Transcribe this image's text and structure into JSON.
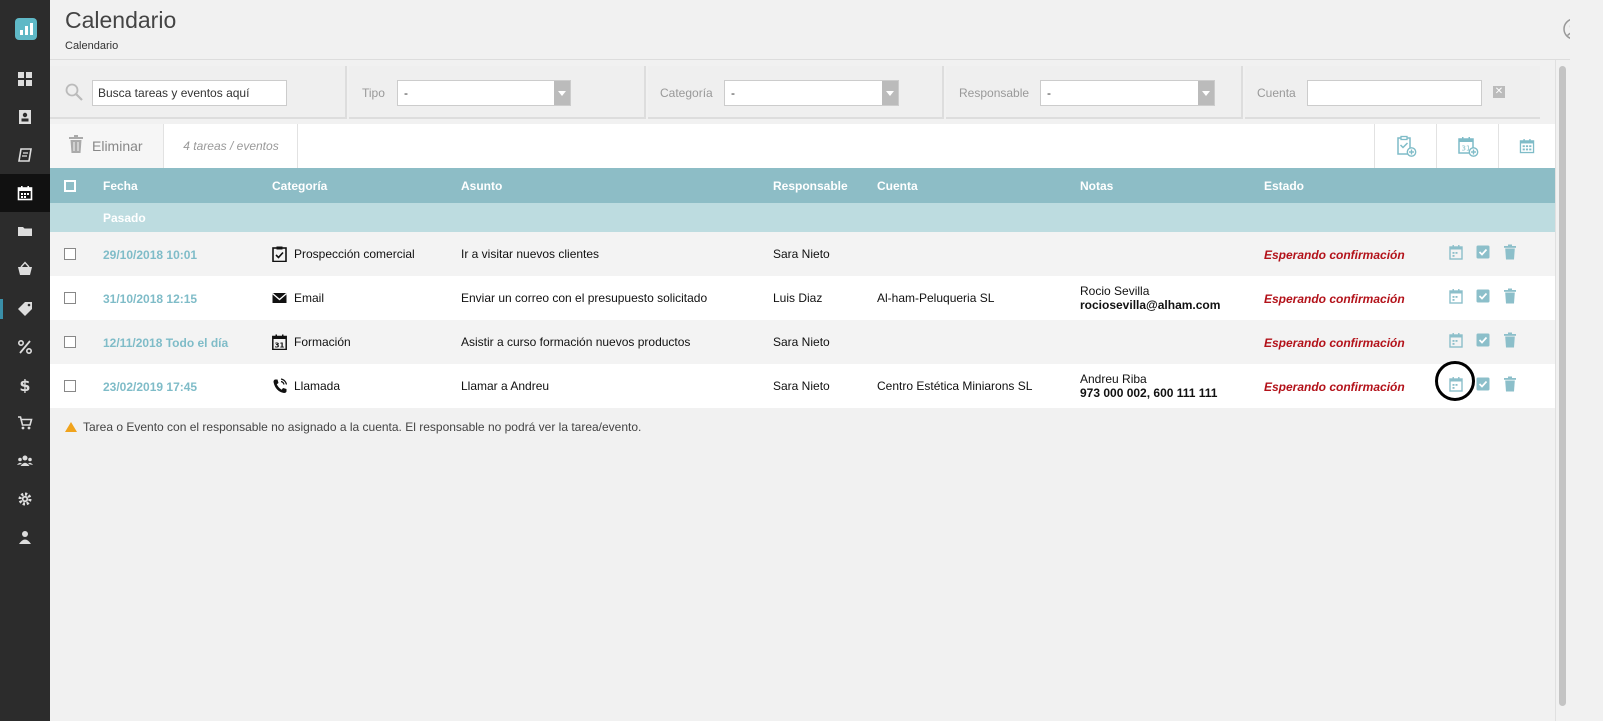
{
  "header": {
    "title": "Calendario",
    "subtitle": "Calendario"
  },
  "sidebar": {
    "items": [
      {
        "icon": "dashboard-icon"
      },
      {
        "icon": "contacts-book-icon"
      },
      {
        "icon": "receipt-icon"
      },
      {
        "icon": "calendar-icon",
        "active": true
      },
      {
        "icon": "folder-icon"
      },
      {
        "icon": "basket-icon"
      },
      {
        "icon": "tag-icon"
      },
      {
        "icon": "percent-icon"
      },
      {
        "icon": "dollar-icon"
      },
      {
        "icon": "cart-icon"
      },
      {
        "icon": "users-icon"
      },
      {
        "icon": "gear-icon"
      },
      {
        "icon": "user-icon"
      }
    ]
  },
  "filters": {
    "search_value": "Busca tareas y eventos aquí",
    "tipo_label": "Tipo",
    "tipo_value": "-",
    "categoria_label": "Categoría",
    "categoria_value": "-",
    "responsable_label": "Responsable",
    "responsable_value": "-",
    "cuenta_label": "Cuenta",
    "cuenta_value": "",
    "clear_glyph": "✕"
  },
  "toolbar": {
    "delete_label": "Eliminar",
    "count_label": "4 tareas / eventos"
  },
  "table": {
    "headers": {
      "fecha": "Fecha",
      "categoria": "Categoría",
      "asunto": "Asunto",
      "responsable": "Responsable",
      "cuenta": "Cuenta",
      "notas": "Notas",
      "estado": "Estado"
    },
    "group_label": "Pasado",
    "rows": [
      {
        "fecha": "29/10/2018 10:01",
        "categoria": "Prospección comercial",
        "cat_icon": "clipboard-check-icon",
        "asunto": "Ir a visitar nuevos clientes",
        "responsable": "Sara Nieto",
        "cuenta": "",
        "notas1": "",
        "notas2": "",
        "estado": "Esperando confirmación"
      },
      {
        "fecha": "31/10/2018 12:15",
        "categoria": "Email",
        "cat_icon": "envelope-icon",
        "asunto": "Enviar un correo con el presupuesto solicitado",
        "responsable": "Luis Diaz",
        "cuenta": "Al-ham-Peluqueria SL",
        "notas1": "Rocio Sevilla",
        "notas2": "rociosevilla@alham.com",
        "estado": "Esperando confirmación"
      },
      {
        "fecha": "12/11/2018 Todo el día",
        "categoria": "Formación",
        "cat_icon": "calendar-31-icon",
        "asunto": "Asistir a curso formación nuevos productos",
        "responsable": "Sara Nieto",
        "cuenta": "",
        "notas1": "",
        "notas2": "",
        "estado": "Esperando confirmación"
      },
      {
        "fecha": "23/02/2019 17:45",
        "categoria": "Llamada",
        "cat_icon": "phone-icon",
        "asunto": "Llamar a Andreu",
        "responsable": "Sara Nieto",
        "cuenta": "Centro Estética Miniarons SL",
        "notas1": "Andreu Riba",
        "notas2": "973 000 002, 600 111 111",
        "estado": "Esperando confirmación"
      }
    ]
  },
  "footer_note": "Tarea o Evento con el responsable no asignado a la cuenta. El responsable no podrá ver la tarea/evento.",
  "colors": {
    "sidebar_bg": "#2c2c2c",
    "header_row": "#8dbdc6",
    "group_row": "#bddce0",
    "date_text": "#7fbcc8",
    "status_text": "#b3121a",
    "action_icon": "#8cbfca"
  }
}
